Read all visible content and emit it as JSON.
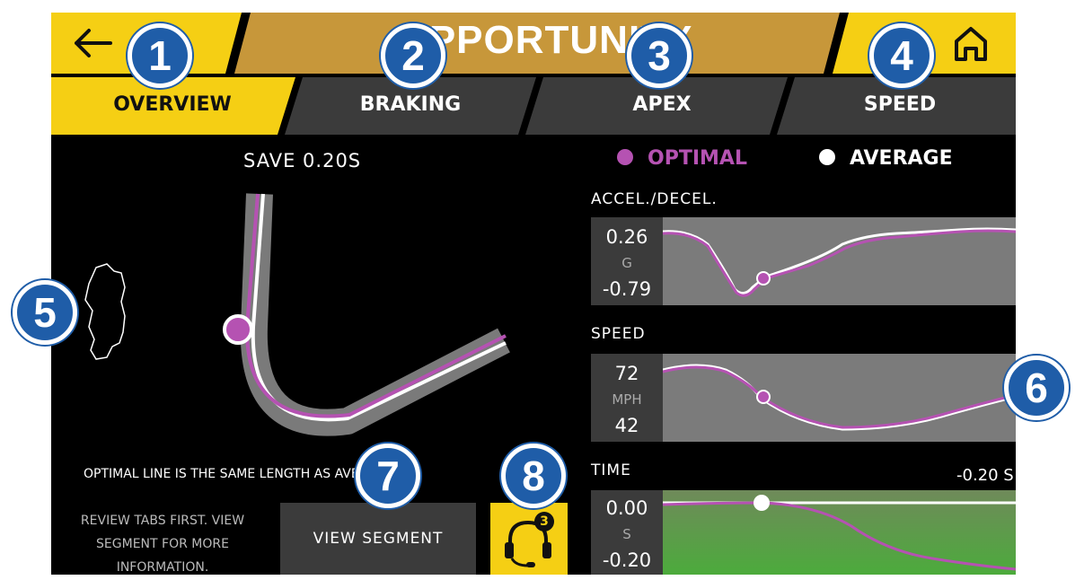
{
  "header": {
    "title": "OPPORTUNITY",
    "back_icon": "arrow-left-icon",
    "home_icon": "home-icon",
    "accent_color": "#f5cf14",
    "title_bar_color": "#c7973a"
  },
  "tabs": [
    {
      "label": "OVERVIEW",
      "active": true
    },
    {
      "label": "BRAKING",
      "active": false
    },
    {
      "label": "APEX",
      "active": false
    },
    {
      "label": "SPEED",
      "active": false
    }
  ],
  "overview": {
    "save_text": "SAVE  0.20S",
    "optimal_line_msg": "OPTIMAL LINE IS THE SAME LENGTH AS AVERAGE",
    "review_text": [
      "REVIEW TABS FIRST. VIEW",
      "SEGMENT FOR MORE",
      "INFORMATION."
    ],
    "view_segment_label": "VIEW SEGMENT",
    "coach_icon": "headset-icon",
    "coach_badge": "3"
  },
  "legend": {
    "optimal_label": "OPTIMAL",
    "optimal_color": "#b552b2",
    "average_label": "AVERAGE",
    "average_color": "#ffffff"
  },
  "graphs": {
    "accel": {
      "label": "ACCEL./DECEL.",
      "top": "0.26",
      "unit": "G",
      "bottom": "-0.79"
    },
    "speed": {
      "label": "SPEED",
      "top": "72",
      "unit": "MPH",
      "bottom": "42"
    },
    "time": {
      "label": "TIME",
      "value": "-0.20 S",
      "top": "0.00",
      "unit": "S",
      "bottom": "-0.20"
    }
  },
  "callouts": [
    "1",
    "2",
    "3",
    "4",
    "5",
    "6",
    "7",
    "8"
  ]
}
